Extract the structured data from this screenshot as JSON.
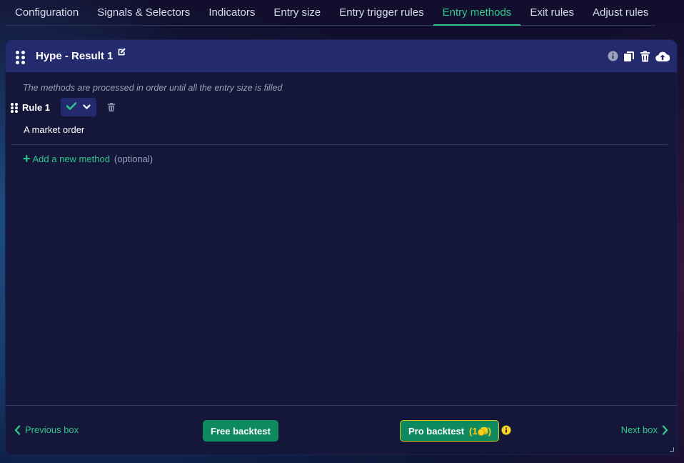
{
  "tabs": [
    {
      "label": "Configuration",
      "active": false
    },
    {
      "label": "Signals & Selectors",
      "active": false
    },
    {
      "label": "Indicators",
      "active": false
    },
    {
      "label": "Entry size",
      "active": false
    },
    {
      "label": "Entry trigger rules",
      "active": false
    },
    {
      "label": "Entry methods",
      "active": true
    },
    {
      "label": "Exit rules",
      "active": false
    },
    {
      "label": "Adjust rules",
      "active": false
    }
  ],
  "colors": {
    "accent": "#2ec98a",
    "header_bg": "#232b6e",
    "card_bg": "#14163a",
    "button_green": "#0f8a5f",
    "coin_yellow": "#f4d21f"
  },
  "card": {
    "title": "Hype - Result 1",
    "header_icons": [
      "info-icon",
      "duplicate-icon",
      "trash-icon",
      "cloud-upload-icon"
    ],
    "hint": "The methods are processed in order until all the entry size is filled",
    "rules": [
      {
        "label": "Rule 1",
        "description": "A market order"
      }
    ],
    "add_method_label": "Add a new method",
    "optional_label": "(optional)"
  },
  "footer": {
    "previous_label": "Previous box",
    "next_label": "Next box",
    "free_backtest_label": "Free backtest",
    "pro_backtest_label": "Pro backtest",
    "pro_credit_prefix": "(1",
    "pro_credit_suffix": ")"
  }
}
